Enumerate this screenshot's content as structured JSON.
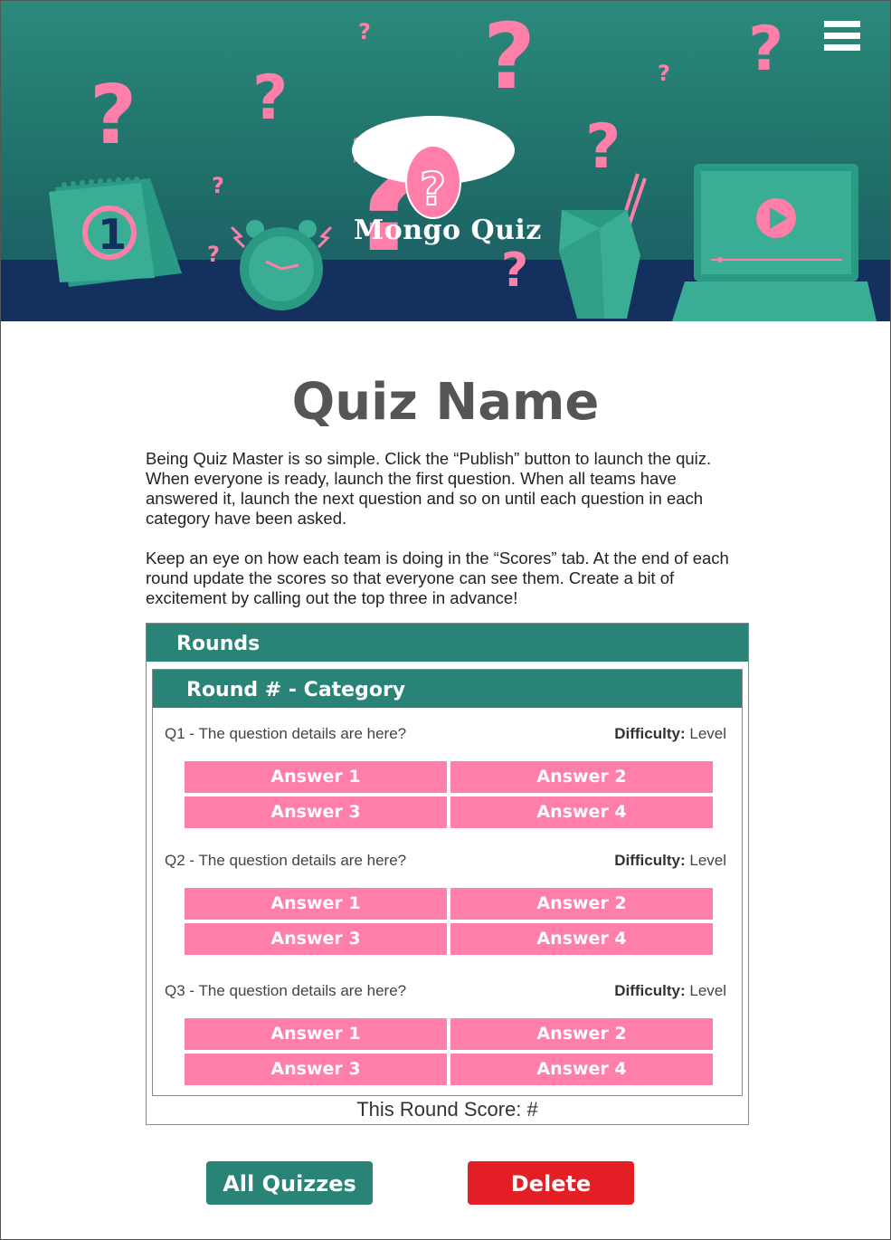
{
  "app": {
    "logo_text": "Mongo Quiz",
    "menu_icon": "hamburger-menu-icon",
    "colors": {
      "teal": "#2a8377",
      "pink": "#ff7fa8",
      "navy": "#13305f",
      "delete_red": "#e31e24"
    }
  },
  "page": {
    "title": "Quiz Name",
    "intro_1": "Being Quiz Master is so simple. Click the “Publish” button to launch the quiz. When everyone is ready, launch the first question. When all teams have answered it, launch the next question and so on until each question in each category have been asked.",
    "intro_2": "Keep an eye on how each team is doing in the “Scores” tab. At the end of each round update the scores so that everyone can see them. Create a bit of excitement by calling out the top three in advance!"
  },
  "rounds": {
    "header": "Rounds",
    "round": {
      "header": "Round # - Category",
      "difficulty_label": "Difficulty:",
      "questions": [
        {
          "text": "Q1 - The question details are here?",
          "difficulty": "Level",
          "answers": [
            "Answer 1",
            "Answer 2",
            "Answer 3",
            "Answer 4"
          ]
        },
        {
          "text": "Q2 - The question details are here?",
          "difficulty": "Level",
          "answers": [
            "Answer 1",
            "Answer 2",
            "Answer 3",
            "Answer 4"
          ]
        },
        {
          "text": "Q3 - The question details are here?",
          "difficulty": "Level",
          "answers": [
            "Answer 1",
            "Answer 2",
            "Answer 3",
            "Answer 4"
          ]
        }
      ],
      "score": "This Round Score: #"
    }
  },
  "actions": {
    "all_quizzes": "All Quizzes",
    "delete": "Delete"
  }
}
